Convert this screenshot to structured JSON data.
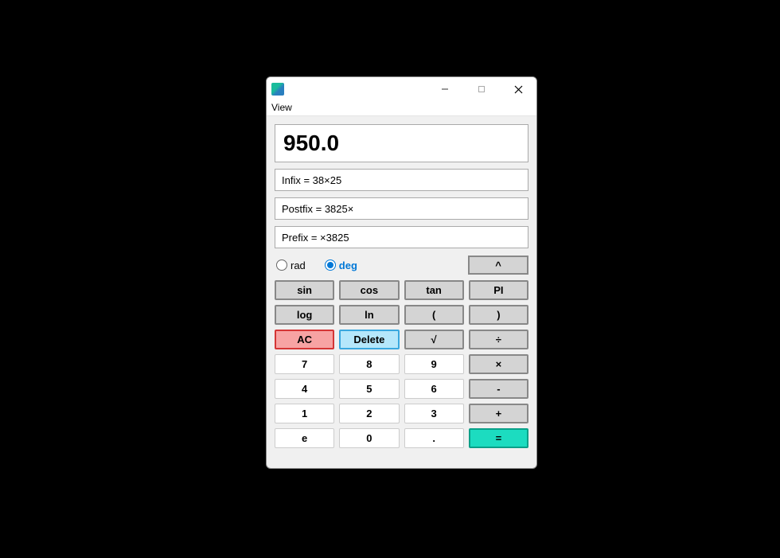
{
  "menubar": {
    "view": "View"
  },
  "displays": {
    "main": "950.0",
    "infix": "Infix = 38×25",
    "postfix": "Postfix = 3825×",
    "prefix": "Prefix = ×3825"
  },
  "mode": {
    "rad_label": "rad",
    "deg_label": "deg",
    "caret": "^"
  },
  "buttons": {
    "sin": "sin",
    "cos": "cos",
    "tan": "tan",
    "pi": "PI",
    "log": "log",
    "ln": "ln",
    "lparen": "(",
    "rparen": ")",
    "ac": "AC",
    "delete": "Delete",
    "sqrt": "√",
    "div": "÷",
    "n7": "7",
    "n8": "8",
    "n9": "9",
    "mul": "×",
    "n4": "4",
    "n5": "5",
    "n6": "6",
    "sub": "-",
    "n1": "1",
    "n2": "2",
    "n3": "3",
    "add": "+",
    "e": "e",
    "n0": "0",
    "dot": ".",
    "eq": "="
  }
}
